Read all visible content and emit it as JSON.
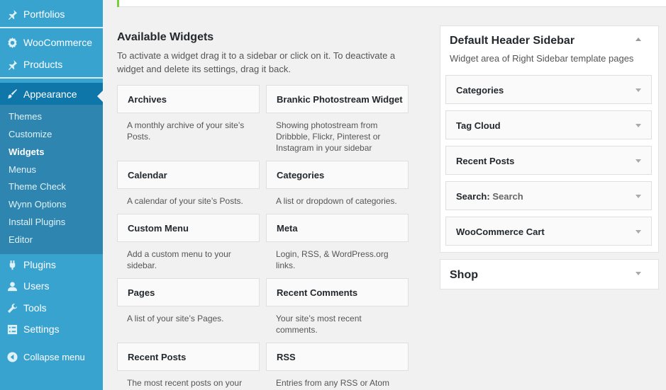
{
  "sidebar": {
    "top_items": [
      {
        "label": "Portfolios",
        "icon": "pin-icon"
      },
      {
        "label": "WooCommerce",
        "icon": "gear-icon"
      },
      {
        "label": "Products",
        "icon": "pin-icon"
      }
    ],
    "current": {
      "label": "Appearance",
      "icon": "brush-icon"
    },
    "submenu": [
      {
        "label": "Themes"
      },
      {
        "label": "Customize"
      },
      {
        "label": "Widgets",
        "current": true
      },
      {
        "label": "Menus"
      },
      {
        "label": "Theme Check"
      },
      {
        "label": "Wynn Options"
      },
      {
        "label": "Install Plugins"
      },
      {
        "label": "Editor"
      }
    ],
    "bottom_items": [
      {
        "label": "Plugins",
        "icon": "plug-icon"
      },
      {
        "label": "Users",
        "icon": "user-icon"
      },
      {
        "label": "Tools",
        "icon": "wrench-icon"
      },
      {
        "label": "Settings",
        "icon": "settings-icon"
      }
    ],
    "collapse_label": "Collapse menu",
    "colors": {
      "bg": "#39a3d0",
      "current": "#0e76a8",
      "submenu": "#2e86b0"
    }
  },
  "available": {
    "title": "Available Widgets",
    "description": "To activate a widget drag it to a sidebar or click on it. To deactivate a widget and delete its settings, drag it back.",
    "widgets": [
      {
        "title": "Archives",
        "desc": "A monthly archive of your site’s Posts."
      },
      {
        "title": "Brankic Photostream Widget",
        "desc": "Showing photostream from Dribbble, Flickr, Pinterest or Instagram in your sidebar"
      },
      {
        "title": "Calendar",
        "desc": "A calendar of your site’s Posts."
      },
      {
        "title": "Categories",
        "desc": "A list or dropdown of categories."
      },
      {
        "title": "Custom Menu",
        "desc": "Add a custom menu to your sidebar."
      },
      {
        "title": "Meta",
        "desc": "Login, RSS, & WordPress.org links."
      },
      {
        "title": "Pages",
        "desc": "A list of your site’s Pages."
      },
      {
        "title": "Recent Comments",
        "desc": "Your site’s most recent comments."
      },
      {
        "title": "Recent Posts",
        "desc": "The most recent posts on your"
      },
      {
        "title": "RSS",
        "desc": "Entries from any RSS or Atom"
      }
    ]
  },
  "header_sidebar": {
    "title": "Default Header Sidebar",
    "description": "Widget area of Right Sidebar template pages",
    "widgets": [
      {
        "title": "Categories",
        "subtitle": ""
      },
      {
        "title": "Tag Cloud",
        "subtitle": ""
      },
      {
        "title": "Recent Posts",
        "subtitle": ""
      },
      {
        "title": "Search",
        "subtitle": "Search"
      },
      {
        "title": "WooCommerce Cart",
        "subtitle": ""
      }
    ]
  },
  "shop_sidebar": {
    "title": "Shop"
  }
}
